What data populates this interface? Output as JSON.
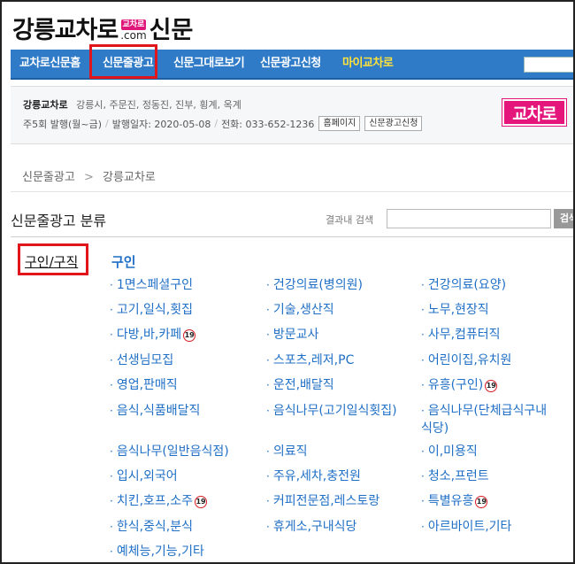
{
  "logo": {
    "main": "강릉교차로",
    "badge": "교차로",
    "domain": ".com",
    "sub": "신문"
  },
  "nav": {
    "items": [
      {
        "label": "교차로신문홈"
      },
      {
        "label": "신문줄광고"
      },
      {
        "label": "신문그대로보기"
      },
      {
        "label": "신문광고신청"
      },
      {
        "label": "마이교차로"
      }
    ]
  },
  "info": {
    "name": "강릉교차로",
    "areas": "강릉시, 주문진, 정동진, 진부, 횡계, 옥계",
    "issue": "주5회 발행(월~금)",
    "date": "발행일자: 2020-05-08",
    "phone": "전화: 033-652-1236",
    "home_btn": "홈페이지",
    "apply_btn": "신문광고신청",
    "brand_logo": "교차로"
  },
  "breadcrumb": {
    "root": "신문줄광고",
    "arrow": ">",
    "current": "강릉교차로"
  },
  "section": {
    "title": "신문줄광고 분류",
    "search_label": "결과내 검색",
    "search_value": "",
    "search_btn": "검색"
  },
  "category": {
    "left": "구인/구직",
    "sub_head": "구인",
    "items": [
      {
        "label": "1면스페셜구인",
        "adult": false
      },
      {
        "label": "건강의료(병의원)",
        "adult": false
      },
      {
        "label": "건강의료(요양)",
        "adult": false
      },
      {
        "label": "고기,일식,횟집",
        "adult": false
      },
      {
        "label": "기술,생산직",
        "adult": false
      },
      {
        "label": "노무,현장직",
        "adult": false
      },
      {
        "label": "다방,바,카페",
        "adult": true
      },
      {
        "label": "방문교사",
        "adult": false
      },
      {
        "label": "사무,컴퓨터직",
        "adult": false
      },
      {
        "label": "선생님모집",
        "adult": false
      },
      {
        "label": "스포츠,레저,PC",
        "adult": false
      },
      {
        "label": "어린이집,유치원",
        "adult": false
      },
      {
        "label": "영업,판매직",
        "adult": false
      },
      {
        "label": "운전,배달직",
        "adult": false
      },
      {
        "label": "유흥(구인)",
        "adult": true
      },
      {
        "label": "음식,식품배달직",
        "adult": false
      },
      {
        "label": "음식나무(고기일식횟집)",
        "adult": false
      },
      {
        "label": "음식나무(단체급식구내식당)",
        "adult": false
      },
      {
        "label": "음식나무(일반음식점)",
        "adult": false
      },
      {
        "label": "의료직",
        "adult": false
      },
      {
        "label": "이,미용직",
        "adult": false
      },
      {
        "label": "입시,외국어",
        "adult": false
      },
      {
        "label": "주유,세차,충전원",
        "adult": false
      },
      {
        "label": "청소,프런트",
        "adult": false
      },
      {
        "label": "치킨,호프,소주",
        "adult": true
      },
      {
        "label": "커피전문점,레스토랑",
        "adult": false
      },
      {
        "label": "특별유흥",
        "adult": true
      },
      {
        "label": "한식,중식,분식",
        "adult": false
      },
      {
        "label": "휴게소,구내식당",
        "adult": false
      },
      {
        "label": "아르바이트,기타",
        "adult": false
      },
      {
        "label": "예체능,기능,기타",
        "adult": false
      }
    ],
    "adult_badge": "19"
  },
  "colors": {
    "nav_bg": "#2f7bc8",
    "link": "#1f6fc6",
    "highlight": "#e0161b",
    "brand": "#e4157b"
  }
}
